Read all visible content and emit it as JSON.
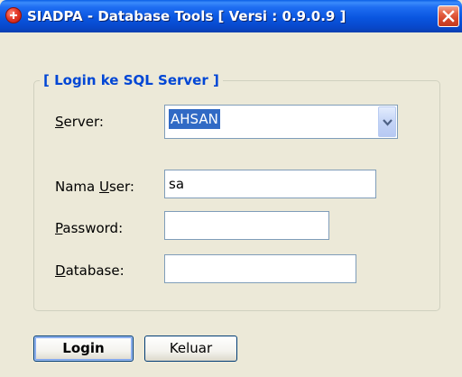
{
  "window": {
    "title": "SIADPA - Database Tools [ Versi : 0.9.0.9 ]",
    "app_icon": "red-plus-icon",
    "close_icon": "close-icon"
  },
  "group": {
    "title": "[ Login ke SQL Server ]"
  },
  "form": {
    "server": {
      "label": "Server:",
      "value": "AHSAN",
      "arrow_icon": "chevron-down-icon"
    },
    "nama_user": {
      "label": "Nama User:",
      "value": "sa"
    },
    "password": {
      "label": "Password:",
      "value": ""
    },
    "database": {
      "label": "Database:",
      "value": ""
    }
  },
  "buttons": {
    "login": "Login",
    "keluar": "Keluar"
  },
  "colors": {
    "titlebar": "#0a57e0",
    "group_title": "#0046d5",
    "selection": "#316ac5",
    "close_button": "#d6472a",
    "dialog_bg": "#ece9d8"
  }
}
